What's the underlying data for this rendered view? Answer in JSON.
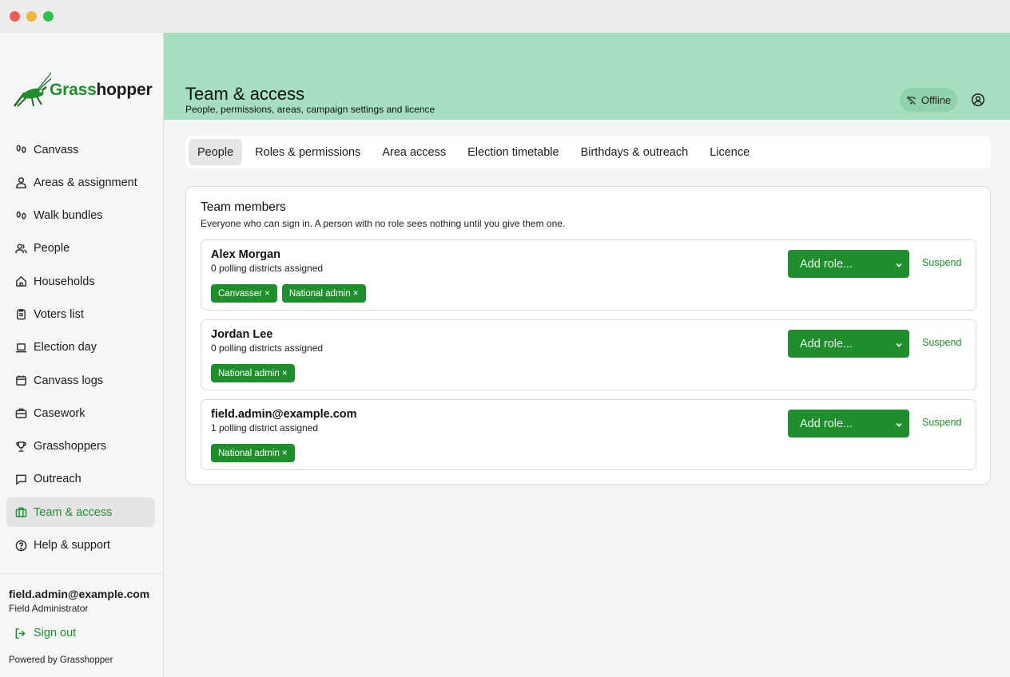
{
  "window": {
    "controls": [
      "close",
      "minimize",
      "zoom"
    ]
  },
  "brand": {
    "name_part1": "Grass",
    "name_part2": "hopper",
    "icon": "grasshopper-logo",
    "colors": {
      "accent": "#1f8f2e",
      "header_bg": "#a5dfbf"
    }
  },
  "sidebar": {
    "items": [
      {
        "label": "Canvass",
        "icon": "footprints-icon",
        "active": false
      },
      {
        "label": "Areas & assignment",
        "icon": "user-icon",
        "active": false
      },
      {
        "label": "Walk bundles",
        "icon": "footprints-icon",
        "active": false
      },
      {
        "label": "People",
        "icon": "users-icon",
        "active": false
      },
      {
        "label": "Households",
        "icon": "house-icon",
        "active": false
      },
      {
        "label": "Voters list",
        "icon": "clipboard-icon",
        "active": false
      },
      {
        "label": "Election day",
        "icon": "laptop-icon",
        "active": false
      },
      {
        "label": "Canvass logs",
        "icon": "calendar-icon",
        "active": false
      },
      {
        "label": "Casework",
        "icon": "briefcase-icon",
        "active": false
      },
      {
        "label": "Grasshoppers",
        "icon": "trophy-icon",
        "active": false
      },
      {
        "label": "Outreach",
        "icon": "message-icon",
        "active": false
      },
      {
        "label": "Team & access",
        "icon": "briefcase-icon",
        "active": true
      },
      {
        "label": "Help & support",
        "icon": "help-circle-icon",
        "active": false
      }
    ],
    "user": {
      "email": "field.admin@example.com",
      "role": "Field Administrator"
    },
    "sign_out_label": "Sign out",
    "powered_by": "Powered by Grasshopper"
  },
  "header": {
    "title": "Team & access",
    "subtitle": "People, permissions, areas, campaign settings and licence",
    "status_label": "Offline",
    "status_icon": "wifi-off-icon",
    "account_icon": "user-circle-icon"
  },
  "tabs": [
    {
      "label": "People",
      "active": true
    },
    {
      "label": "Roles & permissions",
      "active": false
    },
    {
      "label": "Area access",
      "active": false
    },
    {
      "label": "Election timetable",
      "active": false
    },
    {
      "label": "Birthdays & outreach",
      "active": false
    },
    {
      "label": "Licence",
      "active": false
    }
  ],
  "team": {
    "title": "Team members",
    "subtitle": "Everyone who can sign in. A person with no role sees nothing until you give them one.",
    "add_role_placeholder": "Add role...",
    "suspend_label": "Suspend",
    "members": [
      {
        "name": "Alex Morgan",
        "detail": "0 polling districts assigned",
        "roles": [
          "Canvasser ×",
          "National admin ×"
        ]
      },
      {
        "name": "Jordan Lee",
        "detail": "0 polling districts assigned",
        "roles": [
          "National admin ×"
        ]
      },
      {
        "name": "field.admin@example.com",
        "detail": "1 polling district assigned",
        "roles": [
          "National admin ×"
        ]
      }
    ]
  }
}
